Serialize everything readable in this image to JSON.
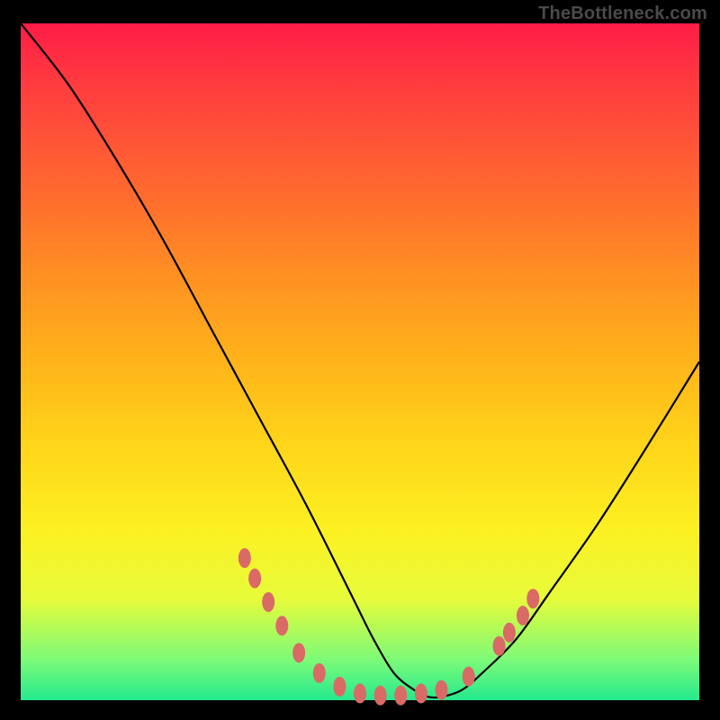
{
  "watermark": "TheBottleneck.com",
  "colors": {
    "page_bg": "#000000",
    "curve": "#000000",
    "marker_fill": "#da6a66",
    "marker_stroke": "#c95a58"
  },
  "chart_data": {
    "type": "line",
    "title": "",
    "xlabel": "",
    "ylabel": "",
    "xlim": [
      0,
      100
    ],
    "ylim": [
      0,
      100
    ],
    "grid": false,
    "legend": false,
    "series": [
      {
        "name": "curve",
        "x": [
          0,
          7,
          14,
          21,
          28,
          35,
          42,
          49,
          52,
          55,
          58,
          60,
          62,
          65,
          68,
          73,
          78,
          85,
          92,
          100
        ],
        "y": [
          100,
          91,
          80,
          68,
          55,
          42,
          29,
          15,
          9,
          4,
          1.5,
          0.5,
          0.5,
          1.5,
          4,
          9,
          16,
          26,
          37,
          50
        ]
      }
    ],
    "markers": [
      {
        "x": 33.0,
        "y": 21.0
      },
      {
        "x": 34.5,
        "y": 18.0
      },
      {
        "x": 36.5,
        "y": 14.5
      },
      {
        "x": 38.5,
        "y": 11.0
      },
      {
        "x": 41.0,
        "y": 7.0
      },
      {
        "x": 44.0,
        "y": 4.0
      },
      {
        "x": 47.0,
        "y": 2.0
      },
      {
        "x": 50.0,
        "y": 1.0
      },
      {
        "x": 53.0,
        "y": 0.7
      },
      {
        "x": 56.0,
        "y": 0.7
      },
      {
        "x": 59.0,
        "y": 1.0
      },
      {
        "x": 62.0,
        "y": 1.5
      },
      {
        "x": 66.0,
        "y": 3.5
      },
      {
        "x": 70.5,
        "y": 8.0
      },
      {
        "x": 72.0,
        "y": 10.0
      },
      {
        "x": 74.0,
        "y": 12.5
      },
      {
        "x": 75.5,
        "y": 15.0
      }
    ]
  }
}
